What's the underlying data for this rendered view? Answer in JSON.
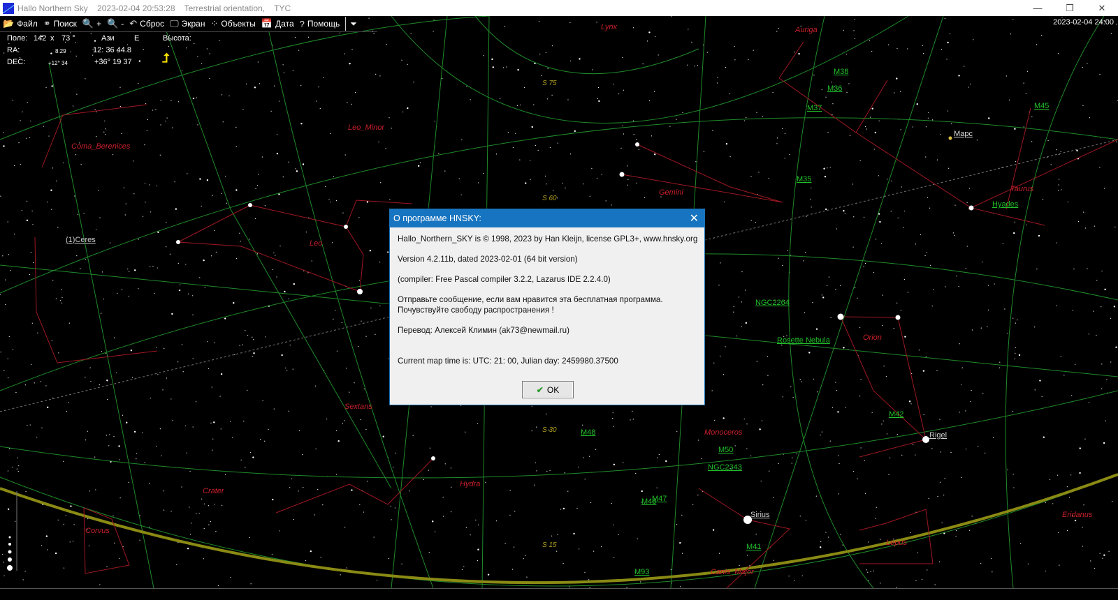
{
  "window": {
    "title": "Hallo Northern Sky",
    "datetime": "2023-02-04  20:53:28",
    "orientation": "Terrestrial orientation,",
    "catalog": "TYC",
    "minimize": "—",
    "maximize": "❐",
    "close": "✕"
  },
  "toolbar": {
    "file": "Файл",
    "search": "Поиск",
    "zoom_in": "+",
    "zoom_out": "-",
    "reset": "Сброс",
    "screen": "Экран",
    "objects": "Объекты",
    "date": "Дата",
    "help": "Помощь",
    "more": "⏷"
  },
  "info": {
    "field_label": "Поле:",
    "field_w": "142",
    "field_x": "x",
    "field_h": "73 °",
    "azi_label": "Ази",
    "azi_value": "E",
    "alt_label": "Высота:",
    "ra_label": "RA:",
    "ra_small": "8:29",
    "ra_value": "12: 36 44.8",
    "dec_label": "DEC:",
    "dec_small": "+12° 34",
    "dec_value": "+36° 19 37"
  },
  "clock": "2023-02-04  24:00",
  "sky_labels": {
    "constellations": [
      "Lynx",
      "Auriga",
      "Leo_Minor",
      "Coma_Berenices",
      "Gemini",
      "Taurus",
      "Leo",
      "Orion",
      "Sextans",
      "Monoceros",
      "Crater",
      "Hydra",
      "Corvus",
      "Lepus",
      "Eridanus",
      "Canis_Major"
    ],
    "objects": [
      "M38",
      "M36",
      "M37",
      "M45",
      "M35",
      "Hyades",
      "NGC2264",
      "Rosette Nebula",
      "M42",
      "M48",
      "M50",
      "NGC2343",
      "M46",
      "M47",
      "M41",
      "M93"
    ],
    "named": [
      "Марс",
      "(1)Ceres",
      "Rigel",
      "Sirius"
    ],
    "grid": [
      "S 75",
      "S 60",
      "S 30",
      "S 15"
    ]
  },
  "dialog": {
    "title": "О программе HNSKY:",
    "line1": "Hallo_Northern_SKY is © 1998, 2023 by Han Kleijn, license GPL3+, www.hnsky.org",
    "line2": "Version 4.2.11b, dated 2023-02-01  (64 bit version)",
    "line3": "(compiler: Free Pascal compiler 3.2.2, Lazarus IDE 2.2.4.0)",
    "line4a": "Отправьте сообщение, если вам нравится эта бесплатная программа.",
    "line4b": "Почувствуйте свободу распространения !",
    "line5": "Перевод: Алексей Климин (ak73@newmail.ru)",
    "line6": "Current map time is: UTC:   21: 00, Julian day:   2459980.37500",
    "ok": "OK"
  }
}
